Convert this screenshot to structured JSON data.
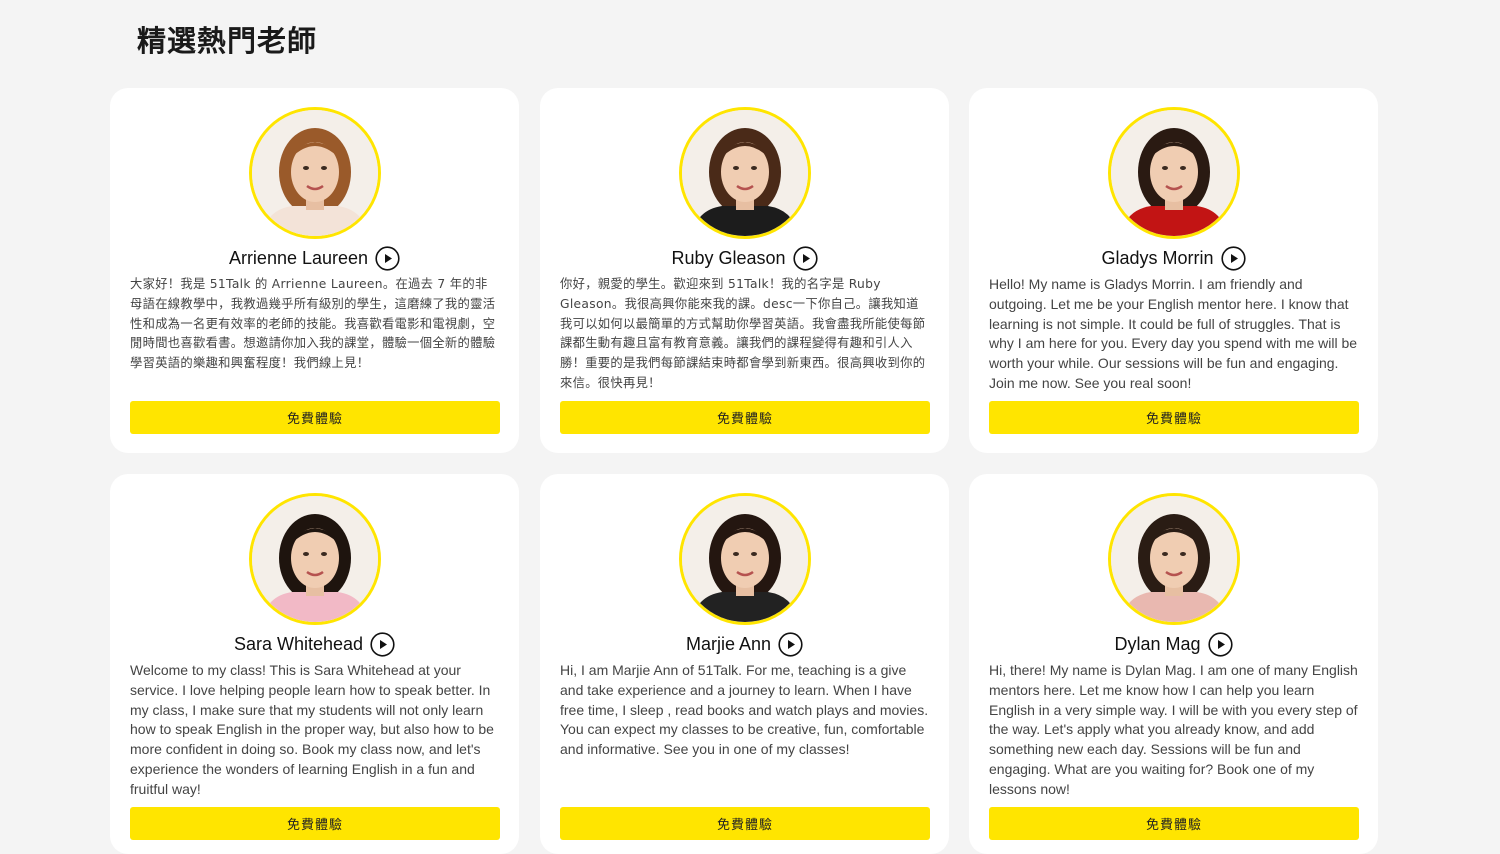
{
  "section": {
    "title": "精選熱門老師"
  },
  "teachers": [
    {
      "name": "Arrienne Laureen",
      "description": "大家好！我是 51Talk 的 Arrienne Laureen。在過去 7 年的非母語在線教學中，我教過幾乎所有級別的學生，這磨練了我的靈活性和成為一名更有效率的老師的技能。我喜歡看電影和電視劇，空閒時間也喜歡看書。想邀請你加入我的課堂，體驗一個全新的體驗學習英語的樂趣和興奮程度！我們線上見！",
      "button_label": "免費體驗",
      "hair_color": "#9a5a2a",
      "top_color": "#f3e3d8"
    },
    {
      "name": "Ruby Gleason",
      "description": "你好，親愛的學生。歡迎來到 51Talk！我的名字是 Ruby Gleason。我很高興你能來我的課。desc一下你自己。讓我知道我可以如何以最簡單的方式幫助你學習英語。我會盡我所能使每節課都生動有趣且富有教育意義。讓我們的課程變得有趣和引人入勝！重要的是我們每節課結束時都會學到新東西。很高興收到你的來信。很快再見！",
      "button_label": "免費體驗",
      "hair_color": "#4a2a18",
      "top_color": "#1c1c1c"
    },
    {
      "name": "Gladys Morrin",
      "description": "Hello! My name is Gladys Morrin. I am friendly and outgoing. Let me be your English mentor here. I know that learning is not simple. It could be full of struggles. That is why I am here for you. Every day you spend with me will be worth your while. Our sessions will be fun and engaging. Join me now. See you real soon!",
      "button_label": "免費體驗",
      "hair_color": "#2a1a12",
      "top_color": "#c21414"
    },
    {
      "name": "Sara Whitehead",
      "description": "Welcome to my class! This is Sara Whitehead at your service. I love helping people learn how to speak better. In my class, I make sure that my students will not only learn how to speak English in the proper way, but also how to be more confident in doing so. Book my class now, and let's experience the wonders of learning English in a fun and fruitful way!",
      "button_label": "免費體驗",
      "hair_color": "#1e140e",
      "top_color": "#f2b9c6"
    },
    {
      "name": "Marjie Ann",
      "description": "Hi, I am Marjie Ann of 51Talk. For me, teaching is a give and take experience and a journey to learn. When I have free time, I sleep , read books and watch plays and movies. You can expect my classes to be creative, fun, comfortable and informative. See you in one of my classes!",
      "button_label": "免費體驗",
      "hair_color": "#241610",
      "top_color": "#222222"
    },
    {
      "name": "Dylan Mag",
      "description": "Hi, there! My name is Dylan Mag. I am one of many English mentors here. Let me know how I can help you learn English in a very simple way. I will be with you every step of the way. Let's apply what you already know, and add something new each day. Sessions will be fun and engaging. What are you waiting for? Book one of my lessons now!",
      "button_label": "免費體驗",
      "hair_color": "#2a1c14",
      "top_color": "#e9b8b0"
    }
  ],
  "accent_color": "#ffe500",
  "icons": {
    "play": "play-circle-icon"
  }
}
